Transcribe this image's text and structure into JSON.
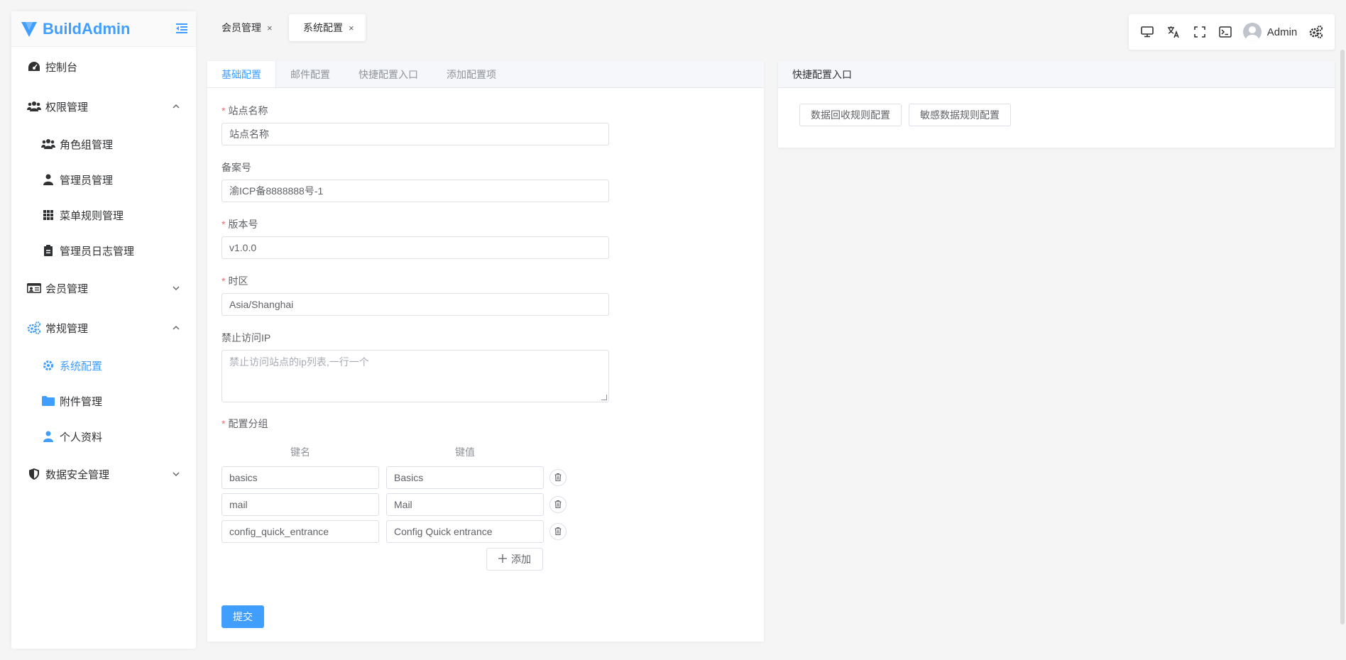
{
  "brand": {
    "name": "BuildAdmin",
    "accent": "#409eff"
  },
  "sidebar": {
    "items": [
      {
        "label": "控制台",
        "icon": "dashboard-icon"
      },
      {
        "label": "权限管理",
        "icon": "users-icon",
        "expanded": true
      },
      {
        "label": "角色组管理",
        "icon": "users-icon"
      },
      {
        "label": "管理员管理",
        "icon": "user-icon"
      },
      {
        "label": "菜单规则管理",
        "icon": "grid-icon"
      },
      {
        "label": "管理员日志管理",
        "icon": "clipboard-icon"
      },
      {
        "label": "会员管理",
        "icon": "id-card-icon",
        "expanded": false
      },
      {
        "label": "常规管理",
        "icon": "cogs-icon",
        "expanded": true
      },
      {
        "label": "系统配置",
        "icon": "gear-icon",
        "active": true
      },
      {
        "label": "附件管理",
        "icon": "folder-icon"
      },
      {
        "label": "个人资料",
        "icon": "user-icon"
      },
      {
        "label": "数据安全管理",
        "icon": "shield-icon",
        "expanded": false
      }
    ]
  },
  "tabs": [
    {
      "label": "会员管理",
      "close": "×"
    },
    {
      "label": "系统配置",
      "close": "×",
      "active": true
    }
  ],
  "toolbar": {
    "user": "Admin"
  },
  "config": {
    "tabs": [
      "基础配置",
      "邮件配置",
      "快捷配置入口",
      "添加配置项"
    ],
    "fields": {
      "site_name": {
        "label": "站点名称",
        "value": "站点名称"
      },
      "record": {
        "label": "备案号",
        "value": "渝ICP备8888888号-1"
      },
      "version": {
        "label": "版本号",
        "value": "v1.0.0"
      },
      "timezone": {
        "label": "时区",
        "value": "Asia/Shanghai"
      },
      "forbidden_ip": {
        "label": "禁止访问IP",
        "placeholder": "禁止访问站点的ip列表,一行一个"
      },
      "group": {
        "label": "配置分组",
        "key_header": "键名",
        "value_header": "键值"
      }
    },
    "groups": [
      {
        "key": "basics",
        "value": "Basics"
      },
      {
        "key": "mail",
        "value": "Mail"
      },
      {
        "key": "config_quick_entrance",
        "value": "Config Quick entrance"
      }
    ],
    "add_label": "添加",
    "submit_label": "提交"
  },
  "quick": {
    "title": "快捷配置入口",
    "buttons": [
      "数据回收规则配置",
      "敏感数据规则配置"
    ]
  }
}
